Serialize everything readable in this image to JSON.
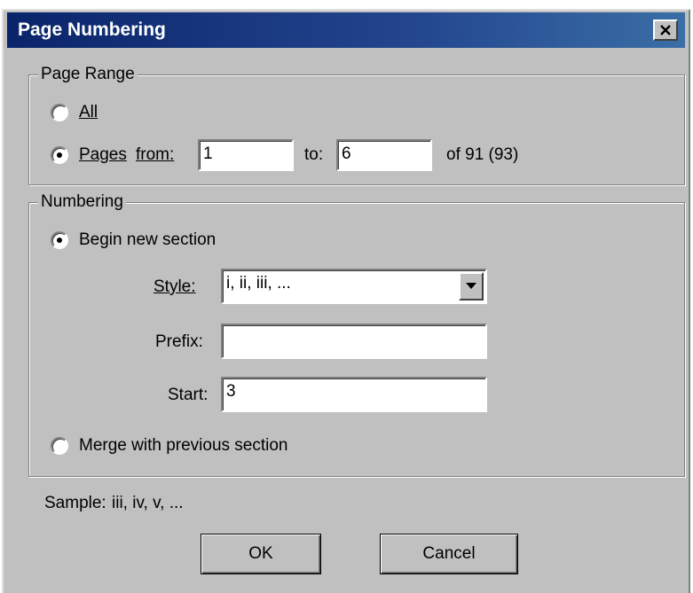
{
  "dialog": {
    "title": "Page Numbering"
  },
  "page_range": {
    "legend": "Page Range",
    "all_label": "All",
    "pages_label_a": "Pages",
    "pages_label_b": "from:",
    "from_value": "1",
    "to_label": "to:",
    "to_value": "6",
    "of_text": "of 91 (93)",
    "selected": "pages"
  },
  "numbering": {
    "legend": "Numbering",
    "begin_new_label": "Begin new section",
    "style_label": "Style:",
    "style_value": "i, ii, iii, ...",
    "prefix_label": "Prefix:",
    "prefix_value": "",
    "start_label": "Start:",
    "start_value": "3",
    "merge_label": "Merge with previous section",
    "selected": "begin_new"
  },
  "sample": {
    "label": "Sample:",
    "value": "iii, iv, v, ..."
  },
  "buttons": {
    "ok": "OK",
    "cancel": "Cancel"
  }
}
